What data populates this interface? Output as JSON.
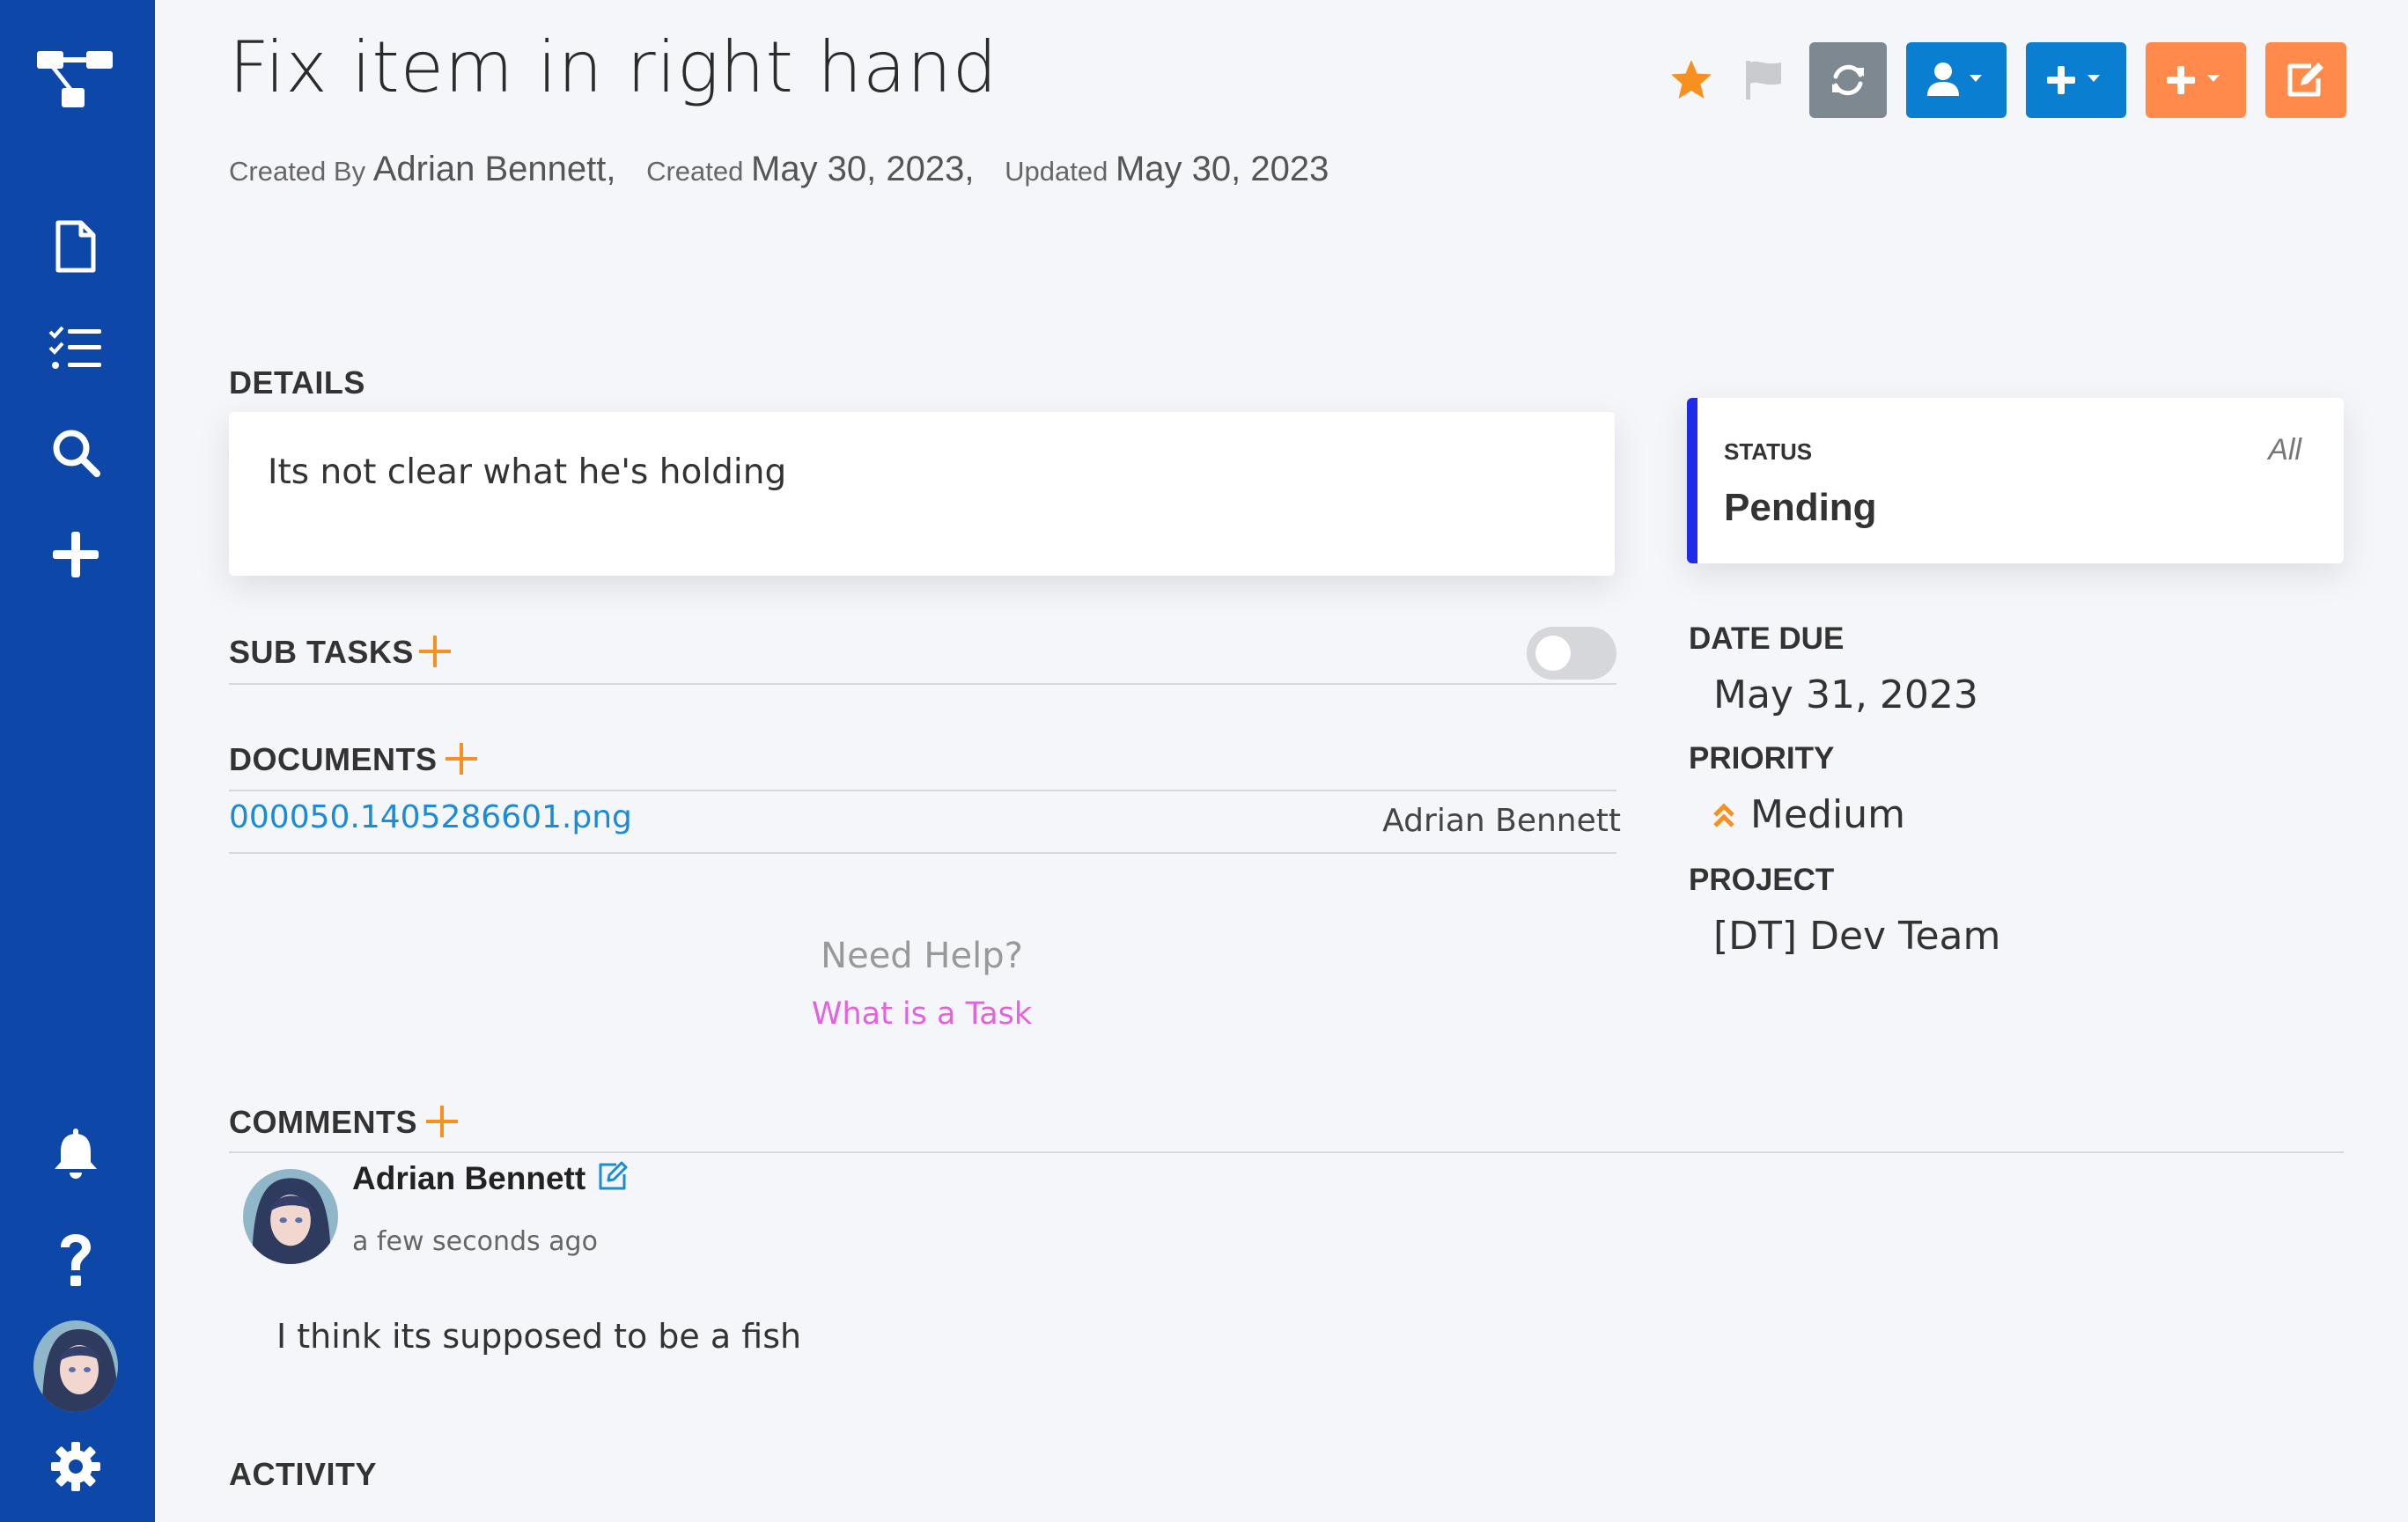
{
  "sidebar": {
    "items": [
      {
        "icon": "sitemap-icon"
      },
      {
        "icon": "document-icon"
      },
      {
        "icon": "tasklist-icon"
      },
      {
        "icon": "search-icon"
      },
      {
        "icon": "plus-icon"
      },
      {
        "icon": "bell-icon"
      },
      {
        "icon": "help-icon"
      },
      {
        "icon": "user-avatar"
      },
      {
        "icon": "gear-icon"
      }
    ],
    "color": "#0d47a8"
  },
  "task": {
    "title": "Fix item in right hand",
    "created_by_label": "Created By",
    "created_by": "Adrian Bennett,",
    "created_label": "Created",
    "created": "May 30, 2023,",
    "updated_label": "Updated",
    "updated": "May 30, 2023"
  },
  "toolbar": {
    "icons": [
      "star-icon",
      "flag-icon",
      "refresh-icon",
      "assign-user-icon",
      "add-icon",
      "add-icon",
      "edit-icon"
    ],
    "colors": {
      "star": "#f7901e",
      "gray": "#7e8891",
      "blue": "#0a7fd1",
      "orange": "#ff8a4c"
    }
  },
  "details": {
    "label": "DETAILS",
    "text": "Its not clear what he's holding"
  },
  "subtasks": {
    "label": "SUB TASKS"
  },
  "documents": {
    "label": "DOCUMENTS",
    "items": [
      {
        "name": "000050.1405286601.png",
        "owner": "Adrian Bennett"
      }
    ]
  },
  "help": {
    "question": "Need Help?",
    "link": "What is a Task"
  },
  "status": {
    "label": "STATUS",
    "filter": "All",
    "value": "Pending",
    "accent": "#1e2be8"
  },
  "date_due": {
    "label": "DATE DUE",
    "value": "May 31, 2023"
  },
  "priority": {
    "label": "PRIORITY",
    "value": "Medium",
    "color": "#f7901e"
  },
  "project": {
    "label": "PROJECT",
    "value": "[DT] Dev Team"
  },
  "comments": {
    "label": "COMMENTS",
    "items": [
      {
        "author": "Adrian Bennett",
        "time": "a few seconds ago",
        "body": "I think its supposed to be a fish"
      }
    ]
  },
  "activity": {
    "label": "ACTIVITY"
  }
}
